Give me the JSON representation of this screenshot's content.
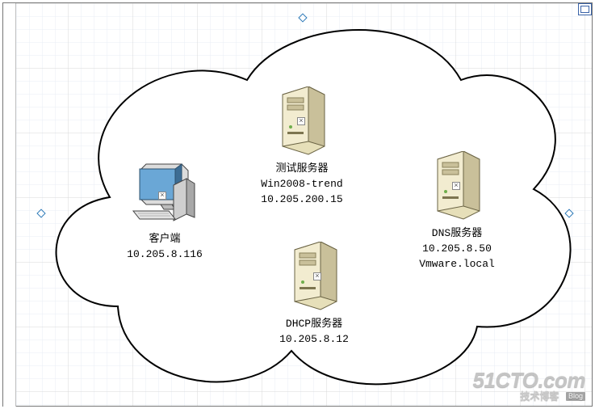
{
  "diagram": {
    "cloud": {
      "selected": true
    },
    "nodes": {
      "client": {
        "type": "workstation",
        "title": "客户端",
        "ip": "10.205.8.116"
      },
      "test_server": {
        "type": "server",
        "title": "测试服务器",
        "hostname": "Win2008-trend",
        "ip": "10.205.200.15"
      },
      "dhcp_server": {
        "type": "server",
        "title": "DHCP服务器",
        "ip": "10.205.8.12"
      },
      "dns_server": {
        "type": "server",
        "title": "DNS服务器",
        "ip": "10.205.8.50",
        "domain": "Vmware.local"
      }
    }
  },
  "watermark": {
    "site": "51CTO.com",
    "tagline": "技术博客",
    "badge": "Blog"
  }
}
